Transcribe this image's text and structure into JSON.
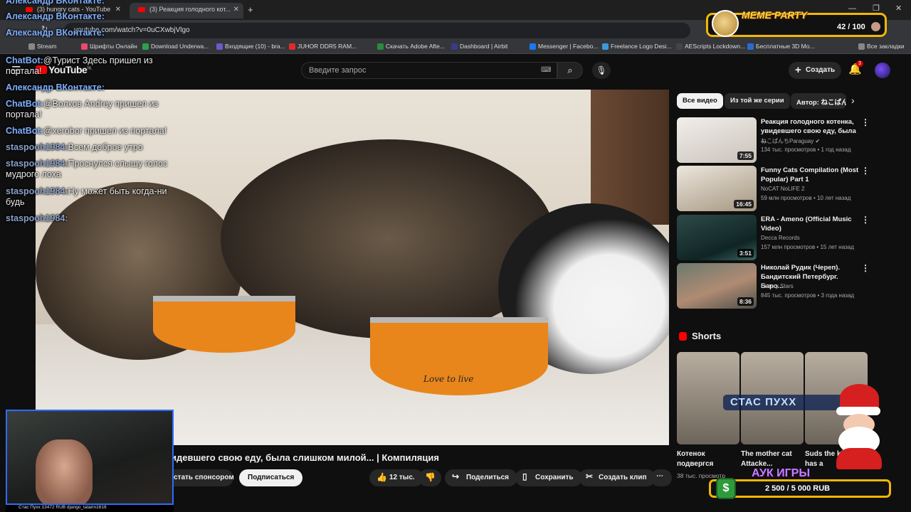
{
  "browser": {
    "tabs": [
      {
        "label": "(3) hungry cats - YouTube"
      },
      {
        "label": "(3) Реакция голодного кот..."
      }
    ],
    "url": "youtube.com/watch?v=0uCXwbjVlgo",
    "bookmarks": [
      "Stream",
      "Шрифты Онлайн",
      "Download Underwa...",
      "Входящие (10) - bra...",
      "JUHOR DDR5 RAM...",
      "Скачать Adobe Afte...",
      "Dashboard | Airbit",
      "Messenger | Facebo...",
      "Freelance Logo Desi...",
      "AEScripts Lockdown...",
      "Бесплатные 3D Mo...",
      "Все закладки"
    ]
  },
  "yt": {
    "logo": "YouTube",
    "logo_region": "NL",
    "search_placeholder": "Введите запрос",
    "create_label": "Создать",
    "notif_count": "3"
  },
  "video": {
    "bowl_text": "Love to live",
    "title": "идевшего свою еду, была слишком милой... | Компиляция",
    "sponsor_label": "стать спонсором",
    "subscribe_label": "Подписаться",
    "likes": "12 тыс.",
    "share_label": "Поделиться",
    "save_label": "Сохранить",
    "clip_label": "Создать клип",
    "more_label": "⋯"
  },
  "sidebar": {
    "chips": [
      "Все видео",
      "Из той же серии",
      "Автор: ねこぱん"
    ],
    "recs": [
      {
        "title": "Реакция голодного котенка, увидевшего свою еду, была ...",
        "channel": "ねこぱんちParaguay ✔",
        "meta": "134 тыс. просмотров • 1 год назад",
        "duration": "7:55"
      },
      {
        "title": "Funny Cats Compilation (Most Popular) Part 1",
        "channel": "NoCAT NoLIFE 2",
        "meta": "59 млн просмотров • 10 лет назад",
        "duration": "16:45"
      },
      {
        "title": "ERA - Ameno (Official Music Video)",
        "channel": "Decca Records",
        "meta": "157 млн просмотров • 15 лет назад",
        "duration": "3:51"
      },
      {
        "title": "Николай Рудик (Череп). Бандитский Петербург. Баро...",
        "channel": "History Stars",
        "meta": "845 тыс. просмотров • 3 года назад",
        "duration": "8:36"
      }
    ],
    "shorts_title": "Shorts",
    "shorts": [
      {
        "title": "Котенок подвергся",
        "meta": "38 тыс. просмотр"
      },
      {
        "title": "The mother cat Attacke...",
        "meta": ""
      },
      {
        "title": "Suds the kitten has a",
        "meta": ""
      }
    ]
  },
  "overlay": {
    "chat": [
      {
        "name": "Александр ВКонтакте:",
        "text": ""
      },
      {
        "name": "Александр ВКонтакте:",
        "text": ""
      },
      {
        "name": "Александр ВКонтакте:",
        "text": ""
      },
      {
        "name": "ChatBot:",
        "text": "@Турист Здесь пришел из"
      },
      {
        "name": "",
        "text": "портала!"
      },
      {
        "name": "Александр ВКонтакте:",
        "text": ""
      },
      {
        "name": "ChatBot:",
        "text": "@Волков Andrey пришел из"
      },
      {
        "name": "",
        "text": "портала!"
      },
      {
        "name": "ChatBot:",
        "text": "@xerobor пришел из портала!"
      },
      {
        "name": "staspooh1984:",
        "text": "Всем доброе утро"
      },
      {
        "name": "staspooh1984:",
        "text": "Проснулся слышу голос"
      },
      {
        "name": "",
        "text": "мудрого лоха"
      },
      {
        "name": "staspooh1984:",
        "text": "Ну может быть когда-ни"
      },
      {
        "name": "",
        "text": "будь"
      },
      {
        "name": "staspooh1984:",
        "text": ""
      }
    ],
    "meme_title": "MEME PARTY",
    "meme_count": "42 / 100",
    "auk_title": "АУК ИГРЫ",
    "auk_value": "2 500 / 5 000 RUB",
    "auk_icon": "$",
    "donor": "СТАС ПУХХ",
    "cam_bar": "Стас Пухх 13472 RUB    django_tatarin1616"
  }
}
